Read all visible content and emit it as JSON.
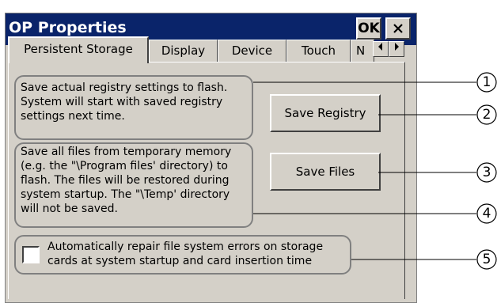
{
  "window": {
    "title": "OP Properties",
    "ok_label": "OK",
    "close_label": "×",
    "colors": {
      "titlebar": "#0a246a",
      "face": "#d4d0c8"
    }
  },
  "tabs": [
    {
      "label": "Persistent Storage",
      "active": true
    },
    {
      "label": "Display"
    },
    {
      "label": "Device"
    },
    {
      "label": "Touch"
    },
    {
      "label": "N"
    }
  ],
  "tab_scroll": {
    "left_icon": "chevron-left-icon",
    "right_icon": "chevron-right-icon"
  },
  "registry": {
    "description": [
      "Save actual registry settings to flash.",
      "System will start with saved registry",
      "settings next time."
    ],
    "button_label": "Save Registry"
  },
  "files": {
    "description": [
      "Save all files from temporary memory",
      "(e.g. the \"\\Program files' directory) to",
      "flash. The files will be restored during",
      "system startup. The \"\\Temp' directory",
      "will not be saved."
    ],
    "button_label": "Save Files"
  },
  "repair": {
    "label": [
      "Automatically repair file system errors on storage",
      "cards at system startup and card insertion time"
    ],
    "checked": false
  },
  "callouts": [
    "1",
    "2",
    "3",
    "4",
    "5"
  ]
}
